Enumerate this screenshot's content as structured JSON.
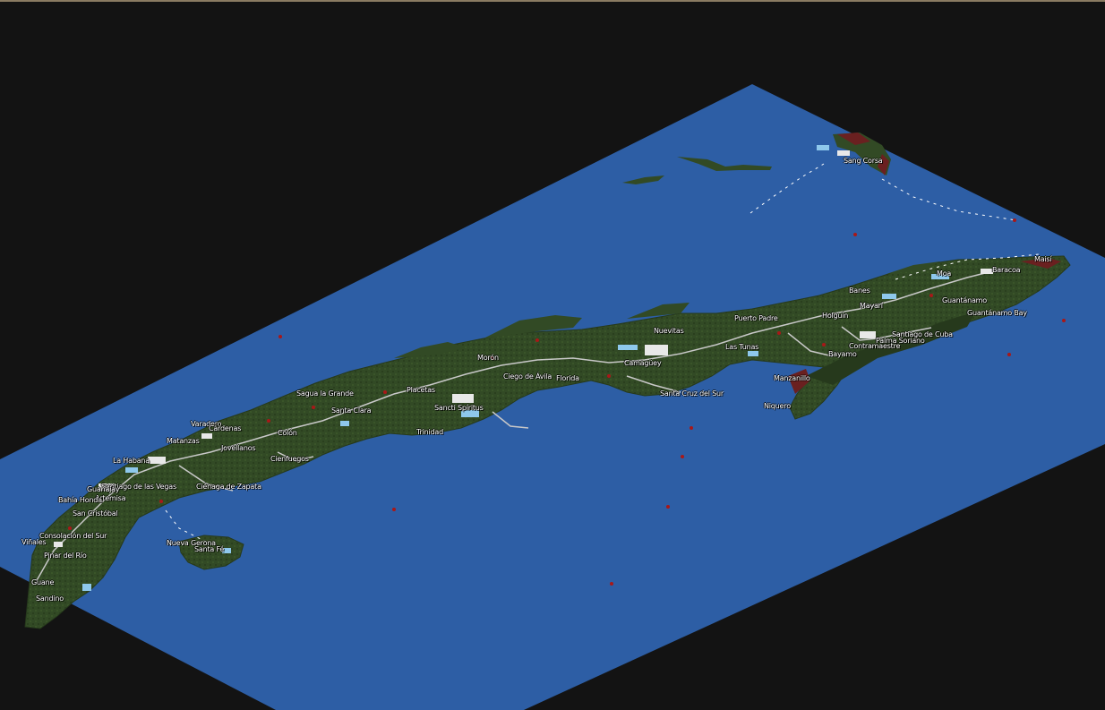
{
  "game": {
    "type": "isometric-tile-map",
    "colors": {
      "background": "#131313",
      "sea": "#2d5ea5",
      "land": "#324a25",
      "land_dark": "#26391c",
      "rock": "#6a2020",
      "town": "#e8e8e8",
      "rail": "#c8c8c8",
      "label": "#ffffff"
    }
  },
  "towns": [
    {
      "name": "Sang Corsa"
    },
    {
      "name": "Maisí"
    },
    {
      "name": "Baracoa"
    },
    {
      "name": "Moa"
    },
    {
      "name": "Banes"
    },
    {
      "name": "Mayarí"
    },
    {
      "name": "Guantánamo"
    },
    {
      "name": "Guantánamo Bay"
    },
    {
      "name": "Puerto Padre"
    },
    {
      "name": "Holguín"
    },
    {
      "name": "Santiago de Cuba"
    },
    {
      "name": "Palma Soriano"
    },
    {
      "name": "Contramaestre"
    },
    {
      "name": "Bayamo"
    },
    {
      "name": "Manzanillo"
    },
    {
      "name": "Niquero"
    },
    {
      "name": "Las Tunas"
    },
    {
      "name": "Nuevitas"
    },
    {
      "name": "Camagüey"
    },
    {
      "name": "Santa Cruz del Sur"
    },
    {
      "name": "Florida"
    },
    {
      "name": "Ciego de Ávila"
    },
    {
      "name": "Morón"
    },
    {
      "name": "Placetas"
    },
    {
      "name": "Sancti Spíritus"
    },
    {
      "name": "Trinidad"
    },
    {
      "name": "Sagua la Grande"
    },
    {
      "name": "Santa Clara"
    },
    {
      "name": "Colón"
    },
    {
      "name": "Cienfuegos"
    },
    {
      "name": "Varadero"
    },
    {
      "name": "Cárdenas"
    },
    {
      "name": "Matanzas"
    },
    {
      "name": "Jovellanos"
    },
    {
      "name": "Ciénaga de Zapata"
    },
    {
      "name": "La Habana"
    },
    {
      "name": "Santiago de las Vegas"
    },
    {
      "name": "Guanajay"
    },
    {
      "name": "Artemisa"
    },
    {
      "name": "Bahía Honda"
    },
    {
      "name": "San Cristóbal"
    },
    {
      "name": "Consolación del Sur"
    },
    {
      "name": "Viñales"
    },
    {
      "name": "Pinar del Río"
    },
    {
      "name": "Guane"
    },
    {
      "name": "Sandino"
    },
    {
      "name": "Nueva Gerona"
    },
    {
      "name": "Santa Fé"
    }
  ]
}
